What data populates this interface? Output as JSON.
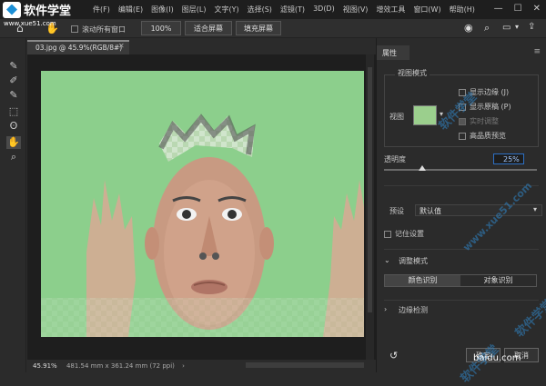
{
  "app": {
    "title": "软件学堂",
    "menu": [
      "件(F)",
      "编辑(E)",
      "图像(I)",
      "图层(L)",
      "文字(Y)",
      "选择(S)",
      "滤镜(T)",
      "3D(D)",
      "视图(V)",
      "增效工具",
      "窗口(W)",
      "帮助(H)"
    ]
  },
  "options": {
    "scroll_all_label": "滚动所有窗口",
    "zoom_label": "100%",
    "fit_label": "适合屏幕",
    "fill_label": "填充屏幕"
  },
  "document": {
    "tab_title": "03.jpg @ 45.9%(RGB/8#)",
    "zoom": "45.91%",
    "dimensions": "481.54 mm x 361.24 mm (72 ppi)"
  },
  "panel": {
    "tab": "属性",
    "view_mode_title": "视图模式",
    "view_label": "视图",
    "checkboxes": {
      "show_edge": "显示边缘 (J)",
      "show_original": "显示原稿 (P)",
      "realtime": "实时调整",
      "hq_preview": "高品质预览"
    },
    "opacity_label": "透明度",
    "opacity_value": "25%",
    "opacity_fraction": 0.25,
    "preset_label": "预设",
    "preset_value": "默认值",
    "remember_label": "记住设置",
    "adjust_mode_title": "调整模式",
    "color_recog": "颜色识别",
    "object_recog": "对象识别",
    "edge_detect_title": "边缘检测",
    "cancel_label": "取消",
    "ok_label": "确定"
  },
  "watermarks": {
    "site": "www.xue51.com",
    "text": "软件学堂",
    "footer": "baidu.com"
  },
  "colors": {
    "accent": "#2d6fc4",
    "canvas_green": "#8ccf8c"
  }
}
